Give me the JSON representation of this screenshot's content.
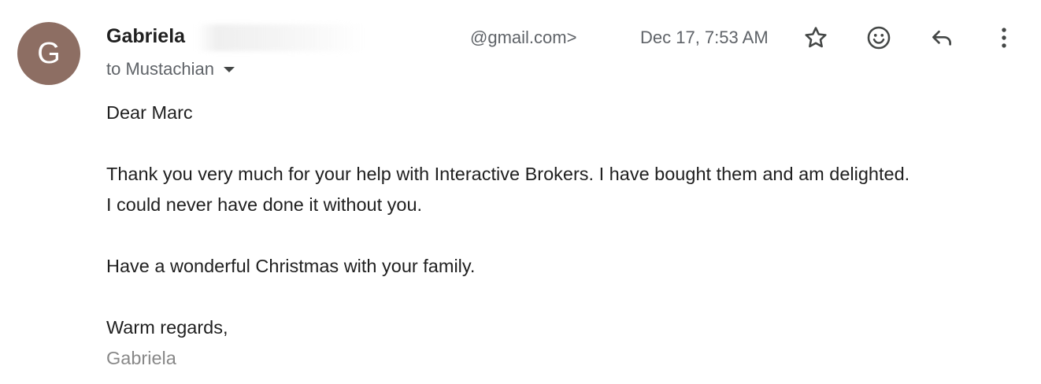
{
  "message": {
    "sender": {
      "avatar_letter": "G",
      "avatar_color": "#8d6e63",
      "name": "Gabriela",
      "email_visible": "@gmail.com>"
    },
    "timestamp": "Dec 17, 7:53 AM",
    "recipient_line": "to Mustachian",
    "actions": {
      "star_icon": "star-outline-icon",
      "emoji_icon": "add-reaction-icon",
      "reply_icon": "reply-icon",
      "more_icon": "more-vertical-icon"
    },
    "body": {
      "greeting": "Dear Marc",
      "paragraph1_line1": "Thank you very much for your help with Interactive Brokers. I have bought them and am delighted.",
      "paragraph1_line2": "I could never have done it without you.",
      "paragraph2": "Have a wonderful Christmas with your family.",
      "closing": "Warm regards,",
      "signature": "Gabriela"
    }
  },
  "colors": {
    "text_primary": "#1f1f1f",
    "text_secondary": "#5f6368",
    "signature_gray": "#888888",
    "icon_color": "#444746"
  }
}
